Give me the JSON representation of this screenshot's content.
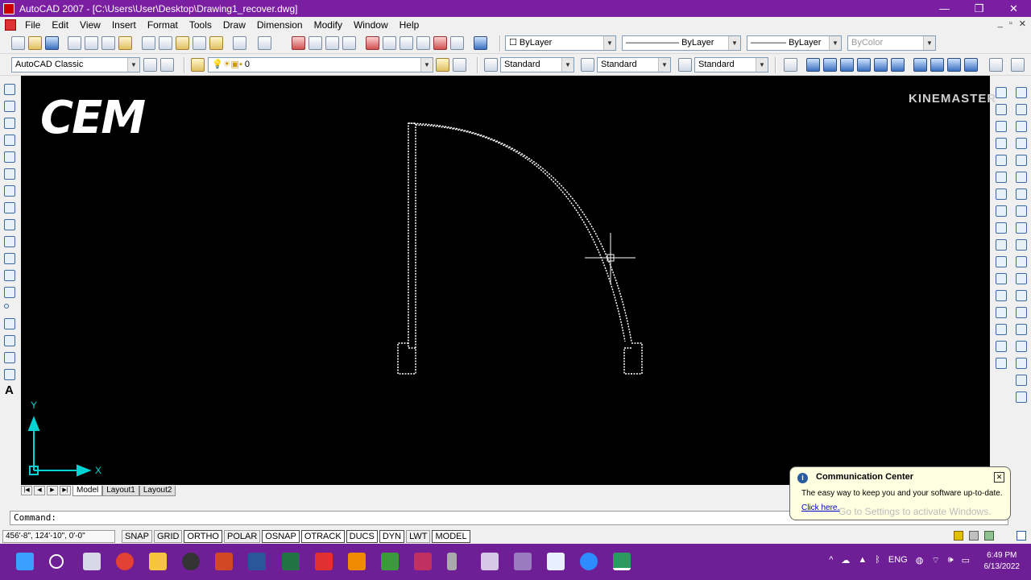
{
  "window": {
    "title": "AutoCAD 2007 - [C:\\Users\\User\\Desktop\\Drawing1_recover.dwg]",
    "minimize": "—",
    "restore": "❐",
    "close": "✕"
  },
  "menu": {
    "items": [
      "File",
      "Edit",
      "View",
      "Insert",
      "Format",
      "Tools",
      "Draw",
      "Dimension",
      "Modify",
      "Window",
      "Help"
    ],
    "doc_minimize": "_",
    "doc_restore": "▫",
    "doc_close": "✕"
  },
  "toolbar1": {
    "color_combo": "ByLayer",
    "linetype_combo": "ByLayer",
    "lineweight_combo": "ByLayer",
    "plotstyle_combo": "ByColor"
  },
  "toolbar2": {
    "workspace_combo": "AutoCAD Classic",
    "layer_combo": "0",
    "text_style_combo": "Standard",
    "dim_style_combo": "Standard",
    "table_style_combo": "Standard"
  },
  "overlays": {
    "cem_logo": "CEM",
    "kinemaster": "KINEMASTER"
  },
  "ucs": {
    "x_label": "X",
    "y_label": "Y"
  },
  "layout_tabs": {
    "nav": [
      "|◀",
      "◀",
      "▶",
      "▶|"
    ],
    "tabs": [
      "Model",
      "Layout1",
      "Layout2"
    ],
    "active": "Model"
  },
  "command": {
    "prompt": "Command:"
  },
  "status": {
    "coords": "456'-8\",  124'-10\", 0'-0\"",
    "toggles": [
      "SNAP",
      "GRID",
      "ORTHO",
      "POLAR",
      "OSNAP",
      "OTRACK",
      "DUCS",
      "DYN",
      "LWT",
      "MODEL"
    ]
  },
  "communication_center": {
    "title": "Communication Center",
    "body": "The easy way to keep you and your software up-to-date.",
    "link": "Click here.",
    "watermark": "Go to Settings to activate Windows."
  },
  "taskbar": {
    "language": "ENG",
    "time": "6:49 PM",
    "date": "6/13/2022"
  },
  "colors": {
    "titlebar": "#7a1fa2",
    "taskbar": "#6f1f95",
    "canvas": "#000000",
    "ucs": "#00d4d4"
  }
}
